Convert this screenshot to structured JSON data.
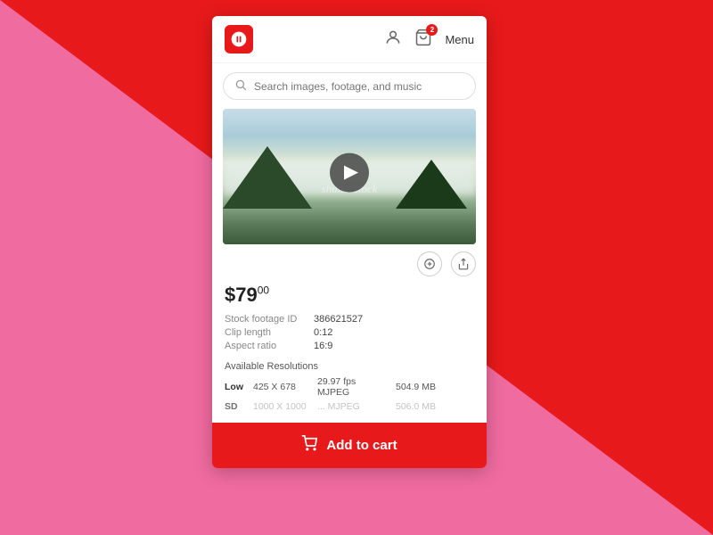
{
  "background": {
    "pink": "#F06BA0",
    "red": "#E8191A"
  },
  "header": {
    "logo_alt": "Shutterstock logo",
    "menu_label": "Menu",
    "cart_badge": "2"
  },
  "search": {
    "placeholder": "Search images, footage, and music"
  },
  "video": {
    "watermark": "shutterstock"
  },
  "price": {
    "whole": "$79",
    "cents": "00"
  },
  "details": {
    "rows": [
      {
        "label": "Stock footage ID",
        "value": "386621527"
      },
      {
        "label": "Clip length",
        "value": "0:12"
      },
      {
        "label": "Aspect ratio",
        "value": "16:9"
      }
    ]
  },
  "resolutions": {
    "title": "Available Resolutions",
    "rows": [
      {
        "quality": "Low",
        "dims": "425 X 678",
        "fps": "29.97 fps MJPEG",
        "size": "504.9 MB"
      },
      {
        "quality": "SD",
        "dims": "1000 X 1000",
        "fps": "...",
        "size": "506.0 MB"
      }
    ]
  },
  "add_to_cart": {
    "label": "Add to cart"
  }
}
